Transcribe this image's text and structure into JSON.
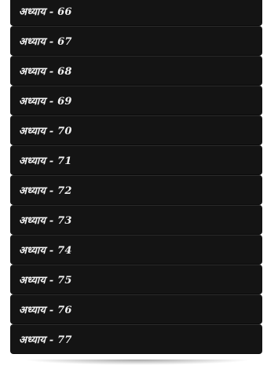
{
  "chapters": [
    {
      "label": "अध्याय - 66"
    },
    {
      "label": "अध्याय - 67"
    },
    {
      "label": "अध्याय - 68"
    },
    {
      "label": "अध्याय - 69"
    },
    {
      "label": "अध्याय - 70"
    },
    {
      "label": "अध्याय - 71"
    },
    {
      "label": "अध्याय - 72"
    },
    {
      "label": "अध्याय - 73"
    },
    {
      "label": "अध्याय - 74"
    },
    {
      "label": "अध्याय - 75"
    },
    {
      "label": "अध्याय - 76"
    },
    {
      "label": "अध्याय - 77"
    }
  ],
  "colors": {
    "item_background": "#141414",
    "item_text": "#f2f2f2",
    "page_background": "#ffffff"
  }
}
